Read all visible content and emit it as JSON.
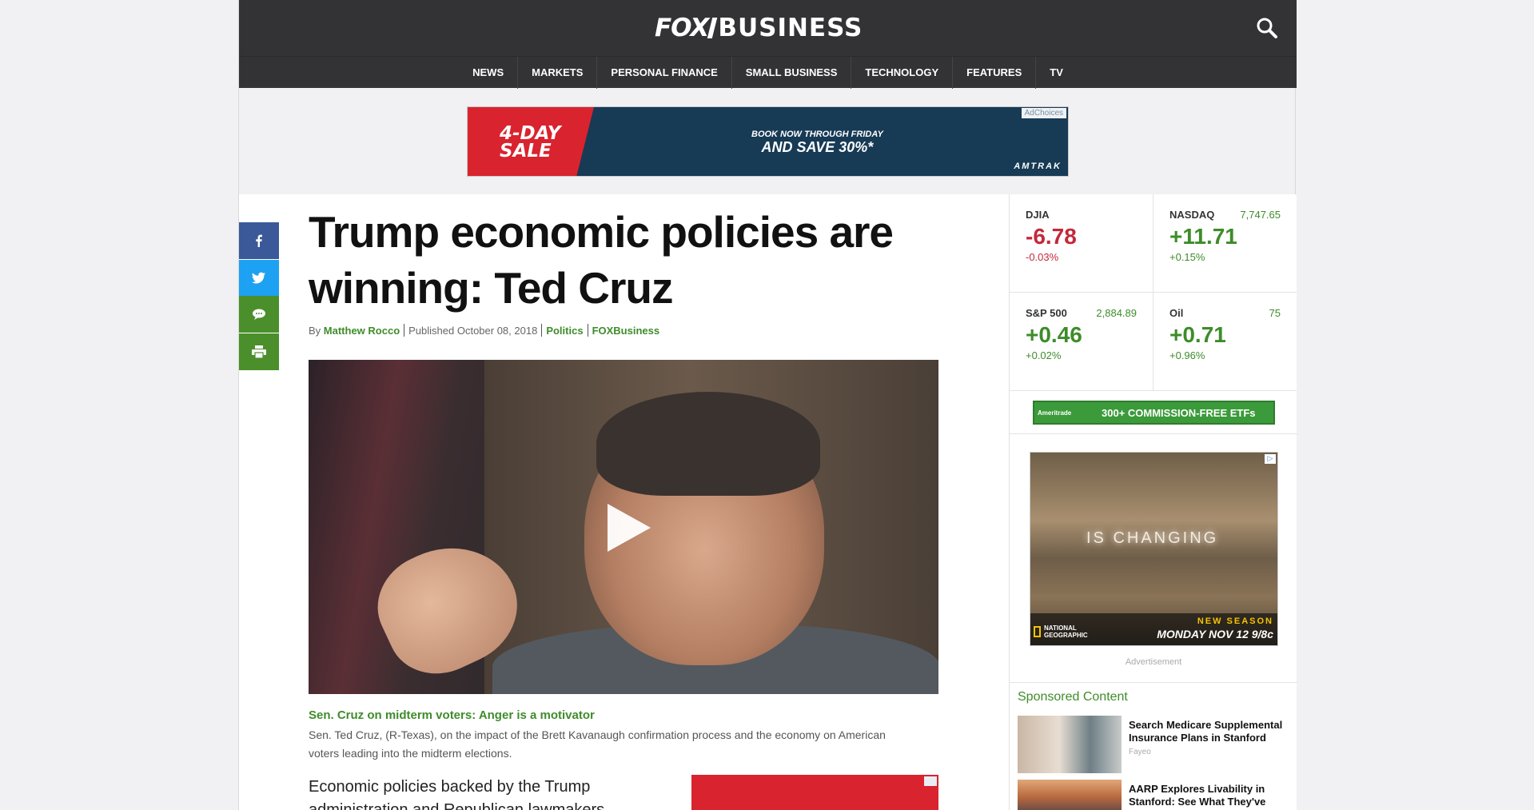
{
  "header": {
    "logo_fox": "FOX",
    "logo_business": "BUSINESS",
    "nav": [
      "NEWS",
      "MARKETS",
      "PERSONAL FINANCE",
      "SMALL BUSINESS",
      "TECHNOLOGY",
      "FEATURES",
      "TV"
    ]
  },
  "leaderboard_ad": {
    "sale_line1": "4-DAY",
    "sale_line2": "SALE",
    "line1": "BOOK NOW THROUGH FRIDAY",
    "line2": "AND SAVE 30%*",
    "brand": "AMTRAK",
    "adchoices": "AdChoices"
  },
  "article": {
    "headline": "Trump economic policies are winning: Ted Cruz",
    "by": "By",
    "author": "Matthew Rocco",
    "published": "Published October 08, 2018",
    "category": "Politics",
    "source": "FOXBusiness",
    "video_caption_title": "Sen. Cruz on midterm voters: Anger is a motivator",
    "video_caption_desc": "Sen. Ted Cruz, (R-Texas), on the impact of the Brett Kavanaugh confirmation process and the economy on American voters leading into the midterm elections.",
    "body": "Economic policies backed by the Trump administration and Republican lawmakers will"
  },
  "tickers": [
    {
      "name": "DJIA",
      "level": "",
      "change": "-6.78",
      "pct": "-0.03%",
      "direction": "neg"
    },
    {
      "name": "NASDAQ",
      "level": "7,747.65",
      "change": "+11.71",
      "pct": "+0.15%",
      "direction": "pos"
    },
    {
      "name": "S&P 500",
      "level": "2,884.89",
      "change": "+0.46",
      "pct": "+0.02%",
      "direction": "pos"
    },
    {
      "name": "Oil",
      "level": "75",
      "change": "+0.71",
      "pct": "+0.96%",
      "direction": "pos"
    }
  ],
  "td_ad": {
    "logo": "Ameritrade",
    "text": "300+ COMMISSION-FREE ETFs"
  },
  "ng_ad": {
    "tagline": "IS CHANGING",
    "network_line1": "NATIONAL",
    "network_line2": "GEOGRAPHIC",
    "new_season": "NEW SEASON",
    "airdate": "MONDAY NOV 12 9/8c"
  },
  "advertisement_label": "Advertisement",
  "sponsored": {
    "title": "Sponsored Content",
    "items": [
      {
        "title": "Search Medicare Supplemental Insurance Plans in Stanford",
        "source": "Fayeo"
      },
      {
        "title": "AARP Explores Livability in Stanford: See What They've Found",
        "source": ""
      }
    ]
  },
  "colors": {
    "accent_green": "#3e8c2a",
    "negative_red": "#c2293b",
    "header_dark": "#333335"
  }
}
